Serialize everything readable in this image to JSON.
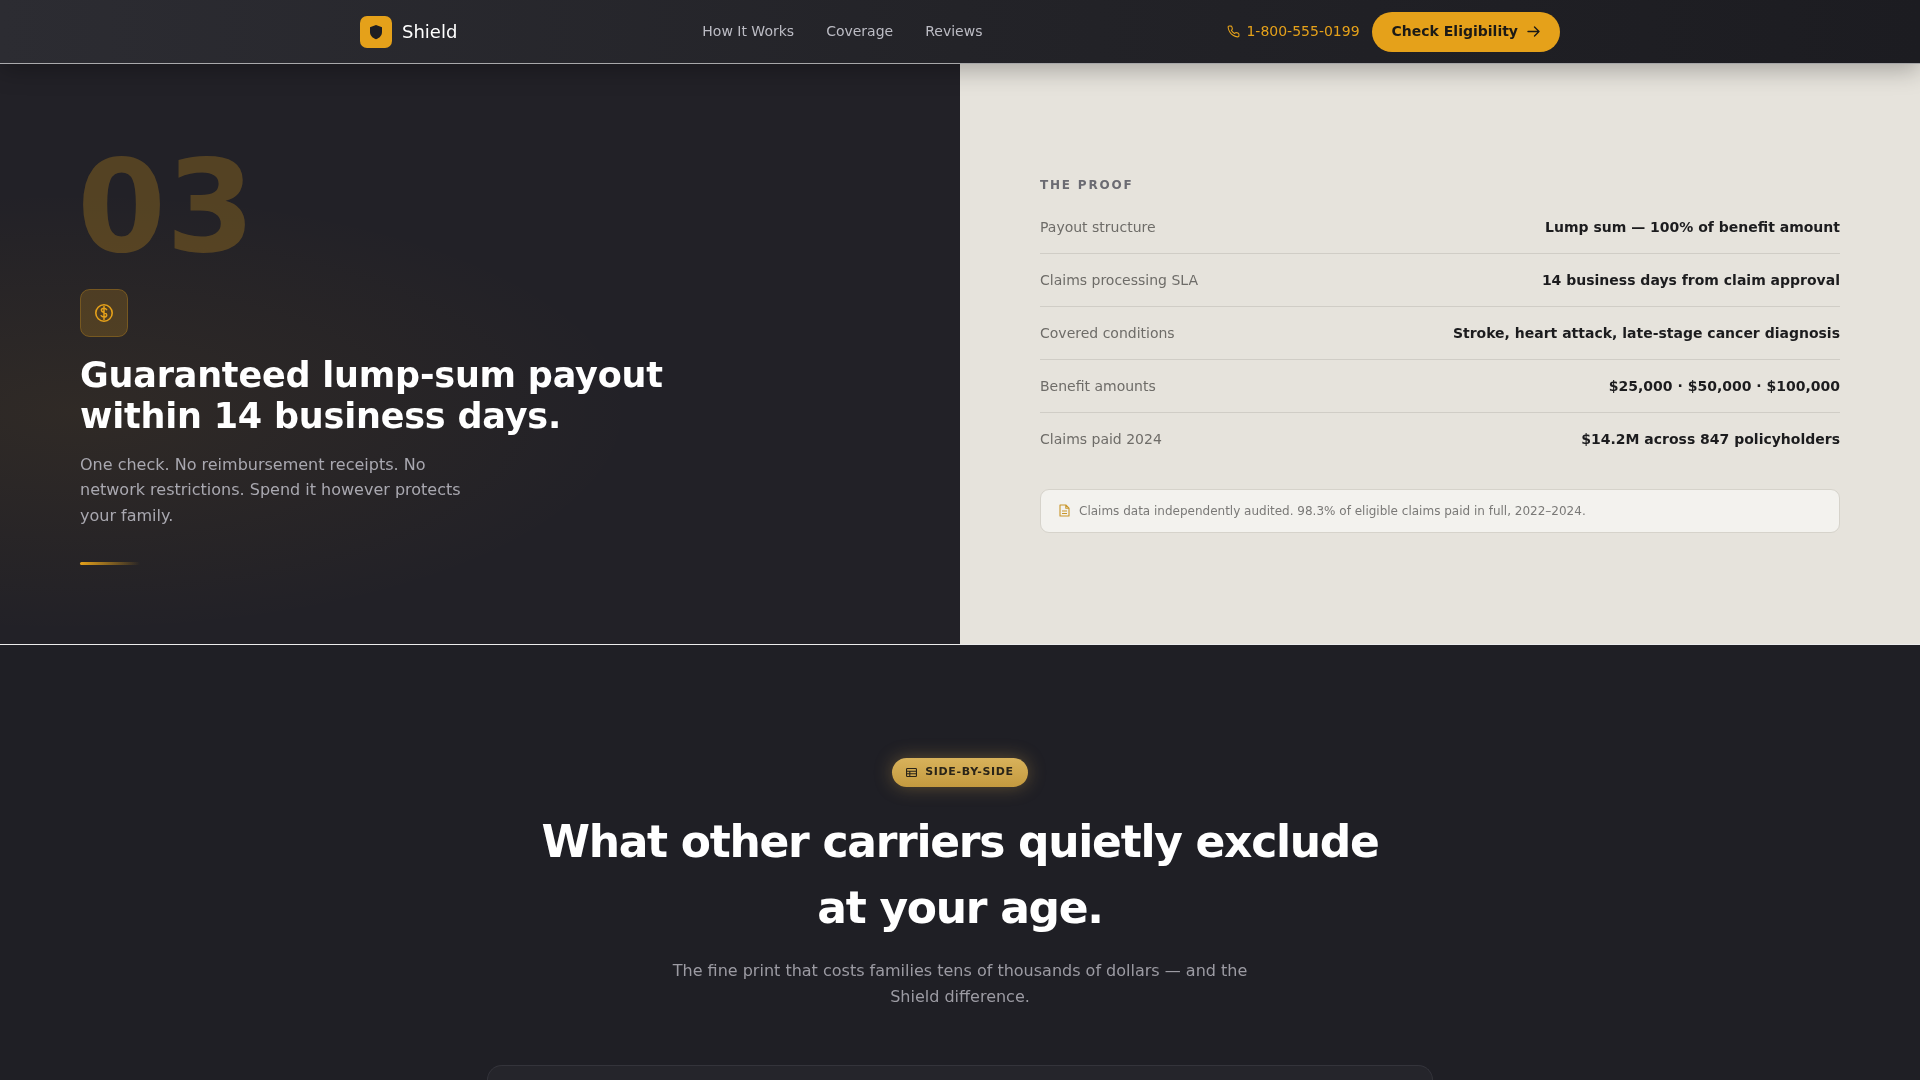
{
  "navbar": {
    "brand": "Shield",
    "links": [
      {
        "label": "How It Works"
      },
      {
        "label": "Coverage"
      },
      {
        "label": "Reviews"
      }
    ],
    "phone": "1-800-555-0199",
    "cta": "Check Eligibility"
  },
  "feature": {
    "number": "03",
    "title": "Guaranteed lump-sum payout within 14 business days.",
    "description": "One check. No reimbursement receipts. No network restrictions. Spend it however protects your family.",
    "proof": {
      "eyebrow": "THE PROOF",
      "rows": [
        {
          "label": "Payout structure",
          "value": "Lump sum — 100% of benefit amount"
        },
        {
          "label": "Claims processing SLA",
          "value": "14 business days from claim approval"
        },
        {
          "label": "Covered conditions",
          "value": "Stroke, heart attack, late-stage cancer diagnosis"
        },
        {
          "label": "Benefit amounts",
          "value": "$25,000 · $50,000 · $100,000"
        },
        {
          "label": "Claims paid 2024",
          "value": "$14.2M across 847 policyholders"
        }
      ],
      "note": "Claims data independently audited. 98.3% of eligible claims paid in full, 2022–2024."
    }
  },
  "comparison": {
    "badge": "SIDE-BY-SIDE",
    "title": "What other carriers quietly exclude at your age.",
    "subtitle": "The fine print that costs families tens of thousands of dollars — and the Shield difference."
  }
}
